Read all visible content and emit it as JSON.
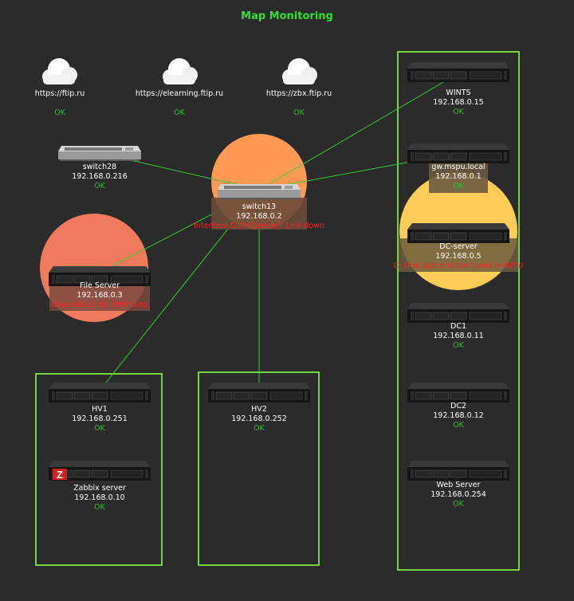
{
  "map": {
    "title": "Map Monitoring",
    "colors": {
      "background": "#2b2b2b",
      "title": "#33dd33",
      "ok": "#2fbf2f",
      "problem": "#ff2020",
      "link": "#33cc33",
      "container": "#88ff44",
      "highlight_high": "#f07a5c",
      "highlight_avg": "#ff9a55",
      "highlight_warn": "#ffcc55"
    },
    "sites": [
      {
        "url": "https://ftip.ru",
        "status": "OK",
        "icon": "cloud-icon"
      },
      {
        "url": "https://elearning.ftip.ru",
        "status": "OK",
        "icon": "cloud-icon"
      },
      {
        "url": "https://zbx.ftip.ru",
        "status": "OK",
        "icon": "cloud-icon"
      }
    ],
    "switch28": {
      "name": "switch28",
      "ip": "192.168.0.216",
      "status": "OK",
      "icon": "switch-icon"
    },
    "switch13": {
      "name": "switch13",
      "ip": "192.168.0.2",
      "problem": "Interface Gi0/4(Server): Link down",
      "icon": "switch-icon"
    },
    "file_server": {
      "name": "File Server",
      "ip": "192.168.0.3",
      "problem": "Unavailable by ICMP ping",
      "icon": "server-icon"
    },
    "hv1": {
      "name": "HV1",
      "ip": "192.168.0.251",
      "status": "OK",
      "icon": "server-icon"
    },
    "zabbix": {
      "name": "Zabbix server",
      "ip": "192.168.0.10",
      "status": "OK",
      "icon": "zabbix-server-icon",
      "badge": "Z"
    },
    "hv2": {
      "name": "HV2",
      "ip": "192.168.0.252",
      "status": "OK",
      "icon": "server-icon"
    },
    "wints": {
      "name": "WINTS",
      "ip": "192.168.0.15",
      "status": "OK",
      "icon": "server-icon"
    },
    "gw": {
      "name": "gw.mspu.local",
      "ip": "192.168.0.1",
      "status": "OK",
      "icon": "server-icon"
    },
    "dc_server": {
      "name": "DC-server",
      "ip": "192.168.0.5",
      "problem": "C: Disk space is low (used > 80%)",
      "icon": "server-icon"
    },
    "dc1": {
      "name": "DC1",
      "ip": "192.168.0.11",
      "status": "OK",
      "icon": "server-icon"
    },
    "dc2": {
      "name": "DC2",
      "ip": "192.168.0.12",
      "status": "OK",
      "icon": "server-icon"
    },
    "web": {
      "name": "Web Server",
      "ip": "192.168.0.254",
      "status": "OK",
      "icon": "server-icon"
    }
  }
}
